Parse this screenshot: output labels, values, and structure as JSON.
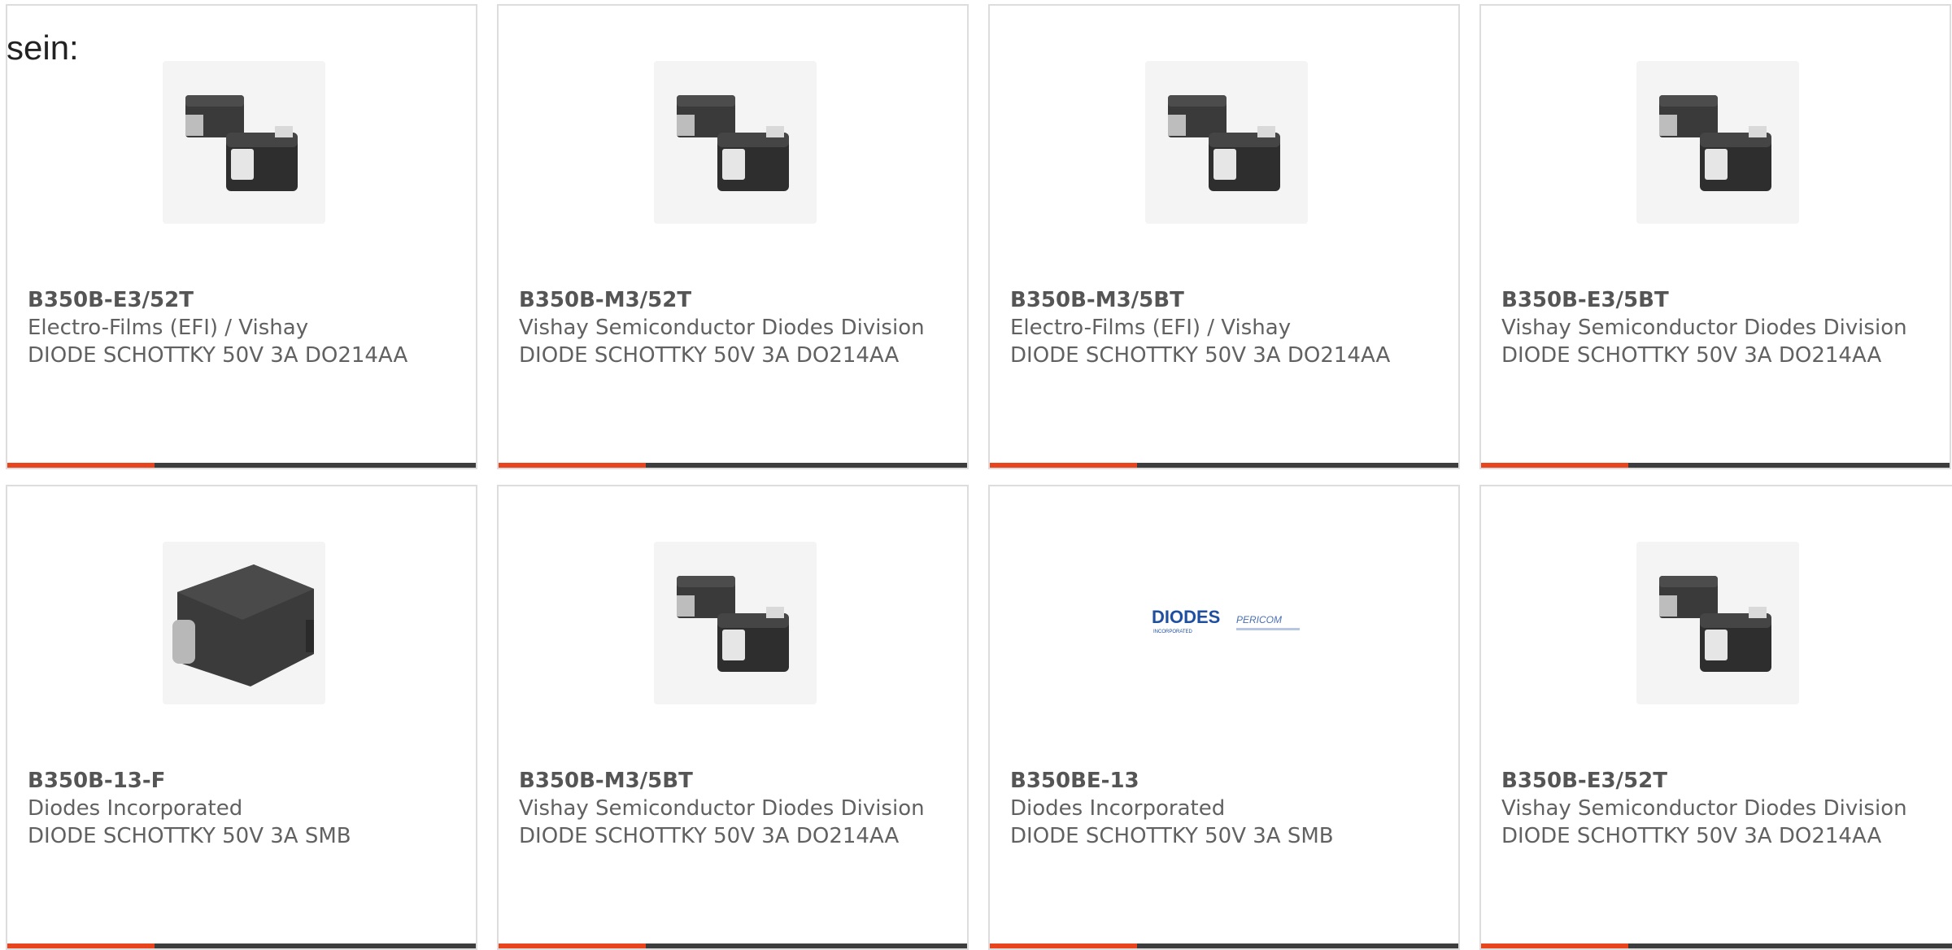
{
  "lead_text": "sein:",
  "colors": {
    "card_border": "#dddddd",
    "footer_bar": "#3d3d3d",
    "footer_accent": "#e8451e",
    "text": "#616161"
  },
  "products": [
    {
      "part_number": "B350B-E3/52T",
      "manufacturer": "Electro-Films (EFI) / Vishay",
      "description": "DIODE SCHOTTKY 50V 3A DO214AA",
      "image": "smd-diode-pair-icon"
    },
    {
      "part_number": "B350B-M3/52T",
      "manufacturer": "Vishay Semiconductor Diodes Division",
      "description": "DIODE SCHOTTKY 50V 3A DO214AA",
      "image": "smd-diode-pair-icon"
    },
    {
      "part_number": "B350B-M3/5BT",
      "manufacturer": "Electro-Films (EFI) / Vishay",
      "description": "DIODE SCHOTTKY 50V 3A DO214AA",
      "image": "smd-diode-pair-icon"
    },
    {
      "part_number": "B350B-E3/5BT",
      "manufacturer": "Vishay Semiconductor Diodes Division",
      "description": "DIODE SCHOTTKY 50V 3A DO214AA",
      "image": "smd-diode-pair-icon"
    },
    {
      "part_number": "B350B-13-F",
      "manufacturer": "Diodes Incorporated",
      "description": "DIODE SCHOTTKY 50V 3A SMB",
      "image": "smb-package-icon"
    },
    {
      "part_number": "B350B-M3/5BT",
      "manufacturer": "Vishay Semiconductor Diodes Division",
      "description": "DIODE SCHOTTKY 50V 3A DO214AA",
      "image": "smd-diode-pair-icon"
    },
    {
      "part_number": "B350BE-13",
      "manufacturer": "Diodes Incorporated",
      "description": "DIODE SCHOTTKY 50V 3A SMB",
      "image": "diodes-pericom-logo",
      "logo_text": "DIODES",
      "logo_sub": "INCORPORATED",
      "logo_text_2": "PERICOM"
    },
    {
      "part_number": "B350B-E3/52T",
      "manufacturer": "Vishay Semiconductor Diodes Division",
      "description": "DIODE SCHOTTKY 50V 3A DO214AA",
      "image": "smd-diode-pair-icon"
    }
  ]
}
